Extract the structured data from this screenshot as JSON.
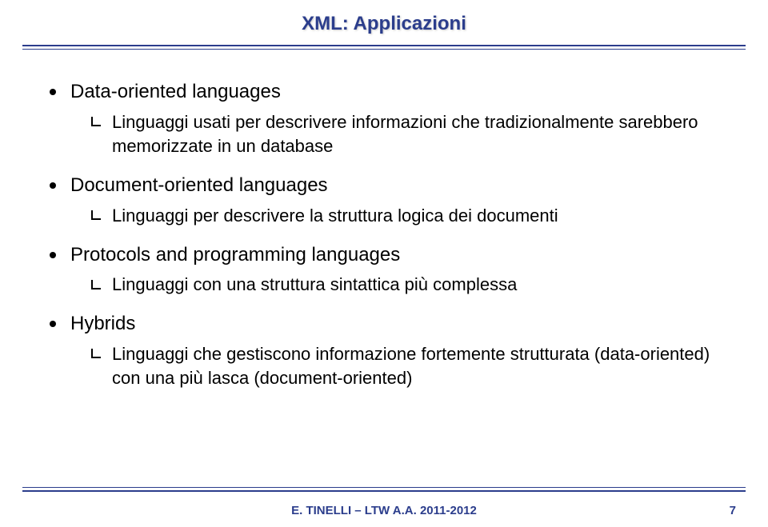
{
  "title": "XML: Applicazioni",
  "items": [
    {
      "label": "Data-oriented languages",
      "sub": [
        "Linguaggi usati per descrivere informazioni che tradizionalmente sarebbero memorizzate in un database"
      ]
    },
    {
      "label": "Document-oriented languages",
      "sub": [
        "Linguaggi per descrivere la struttura logica dei documenti"
      ]
    },
    {
      "label": "Protocols and programming languages",
      "sub": [
        "Linguaggi con una struttura sintattica più complessa"
      ]
    },
    {
      "label": "Hybrids",
      "sub": [
        "Linguaggi che gestiscono informazione fortemente strutturata (data-oriented) con una più lasca (document-oriented)"
      ]
    }
  ],
  "footer": {
    "text": "E. TINELLI – LTW A.A. 2011-2012",
    "page": "7"
  }
}
